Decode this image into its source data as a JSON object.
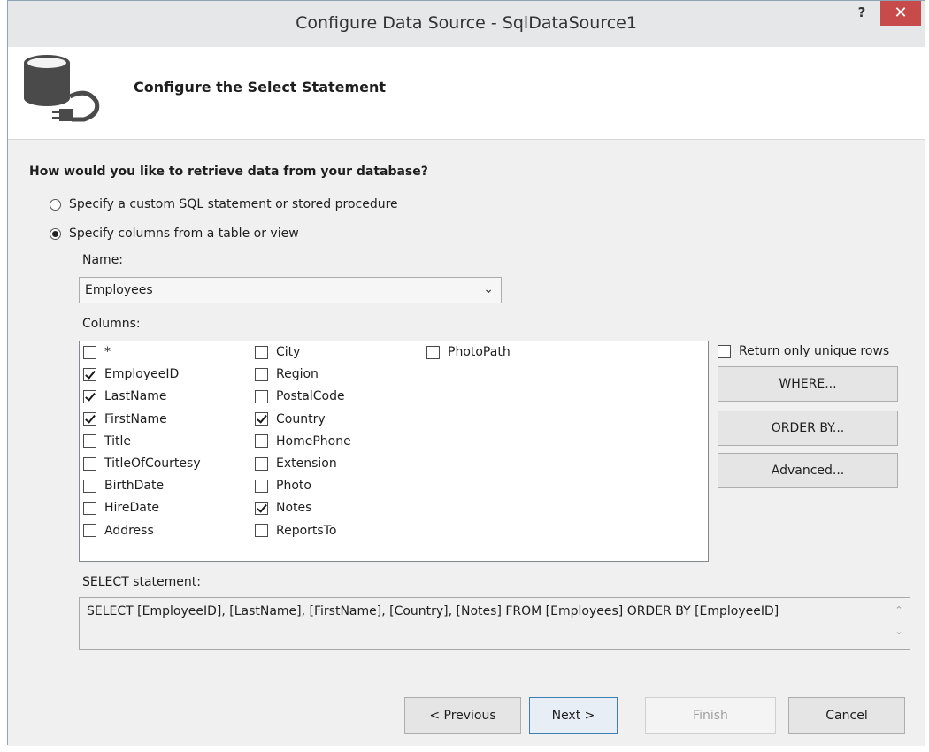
{
  "window": {
    "title": "Configure Data Source - SqlDataSource1",
    "help_label": "?",
    "close_label": "✕"
  },
  "header": {
    "title": "Configure the Select Statement",
    "icon": "database-plug-icon"
  },
  "question": "How would you like to retrieve data from your database?",
  "options": [
    {
      "label": "Specify a custom SQL statement or stored procedure",
      "checked": false
    },
    {
      "label": "Specify columns from a table or view",
      "checked": true
    }
  ],
  "name_field": {
    "label": "Name:",
    "value": "Employees"
  },
  "columns": {
    "label": "Columns:",
    "items": [
      {
        "label": "*",
        "checked": false
      },
      {
        "label": "EmployeeID",
        "checked": true
      },
      {
        "label": "LastName",
        "checked": true
      },
      {
        "label": "FirstName",
        "checked": true
      },
      {
        "label": "Title",
        "checked": false
      },
      {
        "label": "TitleOfCourtesy",
        "checked": false
      },
      {
        "label": "BirthDate",
        "checked": false
      },
      {
        "label": "HireDate",
        "checked": false
      },
      {
        "label": "Address",
        "checked": false
      },
      {
        "label": "City",
        "checked": false
      },
      {
        "label": "Region",
        "checked": false
      },
      {
        "label": "PostalCode",
        "checked": false
      },
      {
        "label": "Country",
        "checked": true
      },
      {
        "label": "HomePhone",
        "checked": false
      },
      {
        "label": "Extension",
        "checked": false
      },
      {
        "label": "Photo",
        "checked": false
      },
      {
        "label": "Notes",
        "checked": true
      },
      {
        "label": "ReportsTo",
        "checked": false
      },
      {
        "label": "PhotoPath",
        "checked": false
      }
    ]
  },
  "unique_rows": {
    "label": "Return only unique rows",
    "checked": false
  },
  "side_buttons": {
    "where": "WHERE...",
    "order_by": "ORDER BY...",
    "advanced": "Advanced..."
  },
  "select_statement": {
    "label": "SELECT statement:",
    "text": "SELECT [EmployeeID], [LastName], [FirstName], [Country], [Notes] FROM [Employees] ORDER BY [EmployeeID]"
  },
  "footer_buttons": {
    "previous": "< Previous",
    "next": "Next >",
    "finish": "Finish",
    "cancel": "Cancel"
  }
}
